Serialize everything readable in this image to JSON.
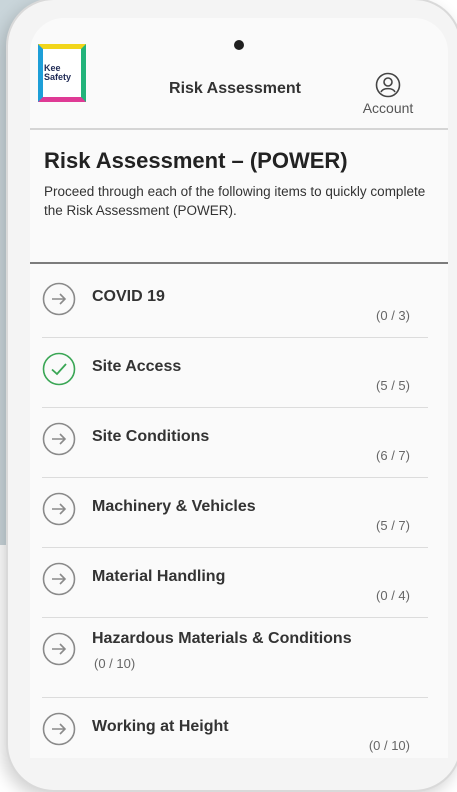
{
  "header": {
    "logo_text": "Kee Safety",
    "title": "Risk Assessment",
    "account_label": "Account"
  },
  "intro": {
    "title": "Risk Assessment – (POWER)",
    "description": "Proceed through each of the following items to quickly complete the Risk Assessment (POWER)."
  },
  "items": [
    {
      "label": "COVID 19",
      "count": "(0 / 3)",
      "status": "pending"
    },
    {
      "label": "Site Access",
      "count": "(5 / 5)",
      "status": "complete"
    },
    {
      "label": "Site Conditions",
      "count": "(6 / 7)",
      "status": "pending"
    },
    {
      "label": "Machinery & Vehicles",
      "count": "(5 / 7)",
      "status": "pending"
    },
    {
      "label": "Material Handling",
      "count": "(0 / 4)",
      "status": "pending"
    },
    {
      "label": "Hazardous Materials & Conditions",
      "count": "(0 / 10)",
      "status": "pending"
    },
    {
      "label": "Working at Height",
      "count": "(0 / 10)",
      "status": "pending"
    }
  ],
  "colors": {
    "complete": "#3aa655",
    "pending": "#8a8a8a"
  }
}
